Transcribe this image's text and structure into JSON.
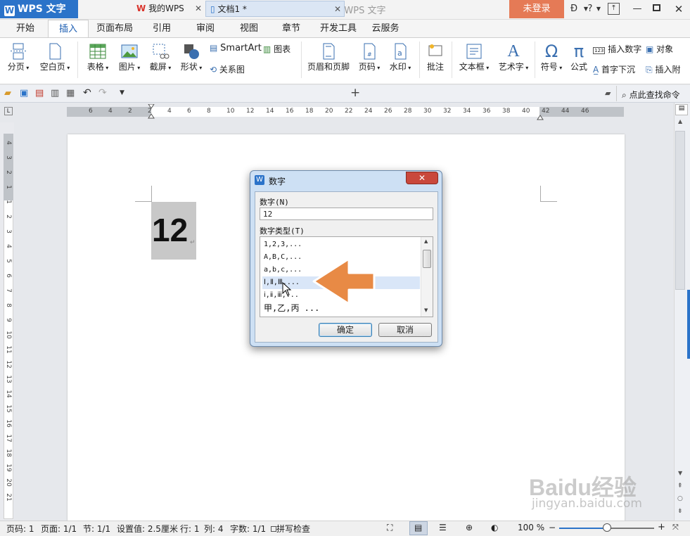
{
  "titlebar": {
    "app_name": "WPS 文字",
    "doc_title": "文档1 * - WPS 文字",
    "login": "未登录",
    "help": "?"
  },
  "menu": {
    "tabs": [
      "开始",
      "插入",
      "页面布局",
      "引用",
      "审阅",
      "视图",
      "章节",
      "开发工具",
      "云服务"
    ],
    "active": "插入"
  },
  "ribbon": {
    "page_break": "分页",
    "blank_page": "空白页",
    "table": "表格",
    "picture": "图片",
    "screenshot": "截屏",
    "shape": "形状",
    "smartart": "SmartArt",
    "chart": "图表",
    "relation": "关系图",
    "header_footer": "页眉和页脚",
    "page_number": "页码",
    "watermark": "水印",
    "comment": "批注",
    "textbox": "文本框",
    "wordart": "艺术字",
    "symbol": "符号",
    "formula": "公式",
    "insert_number": "插入数字",
    "object": "对象",
    "drop_cap": "首字下沉",
    "insert_attach": "插入附"
  },
  "tabs": {
    "tab1": "我的WPS",
    "tab2": "文档1 *",
    "search": "点此查找命令"
  },
  "ruler": {
    "h_numbers": [
      "6",
      "4",
      "2",
      "2",
      "4",
      "6",
      "8",
      "10",
      "12",
      "14",
      "16",
      "18",
      "20",
      "22",
      "24",
      "26",
      "28",
      "30",
      "32",
      "34",
      "36",
      "38",
      "40",
      "42",
      "44",
      "46"
    ],
    "v_numbers": [
      "4",
      "3",
      "2",
      "1",
      "1",
      "2",
      "3",
      "4",
      "5",
      "6",
      "7",
      "8",
      "9",
      "10",
      "11",
      "12",
      "13",
      "14",
      "15",
      "16",
      "17",
      "18",
      "19",
      "20",
      "21"
    ]
  },
  "document": {
    "content": "12"
  },
  "dialog": {
    "title": "数字",
    "number_label": "数字(N)",
    "number_value": "12",
    "type_label": "数字类型(T)",
    "types": [
      "1,2,3,...",
      "A,B,C,...",
      "a,b,c,...",
      "Ⅰ,Ⅱ,Ⅲ,...",
      "ⅰ,ⅱ,ⅲ,...",
      "甲,乙,丙 ..."
    ],
    "selected_index": 3,
    "ok": "确定",
    "cancel": "取消"
  },
  "status": {
    "page_no": "页码: 1",
    "pages": "页面: 1/1",
    "section": "节: 1/1",
    "setting": "设置值: 2.5厘米",
    "row": "行: 1",
    "col": "列: 4",
    "words": "字数: 1/1",
    "spell": "拼写检查",
    "zoom": "100 %",
    "zoom_level": 0.5
  },
  "watermark": {
    "brand": "Baidu经验",
    "url": "jingyan.baidu.com"
  },
  "colors": {
    "accent": "#2b73c9",
    "login": "#e57a56",
    "arrow": "#e88a45"
  }
}
